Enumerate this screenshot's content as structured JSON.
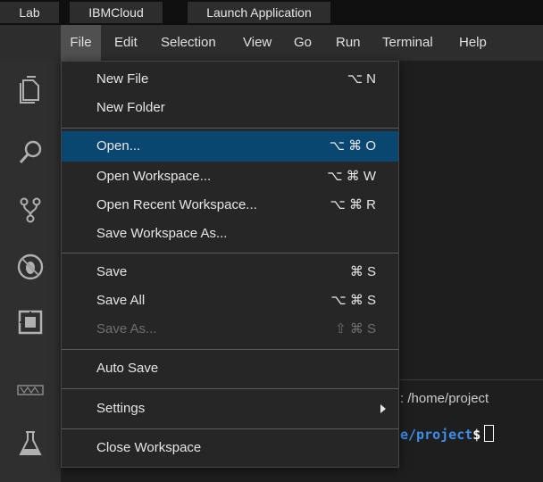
{
  "top_tabs": [
    {
      "label": "Lab"
    },
    {
      "label": "IBMCloud"
    },
    {
      "label": "Launch Application"
    }
  ],
  "menubar": [
    {
      "label": "File"
    },
    {
      "label": "Edit"
    },
    {
      "label": "Selection"
    },
    {
      "label": "View"
    },
    {
      "label": "Go"
    },
    {
      "label": "Run"
    },
    {
      "label": "Terminal"
    },
    {
      "label": "Help"
    }
  ],
  "activity_icons": [
    "files-icon",
    "search-icon",
    "source-control-icon",
    "debug-icon",
    "extensions-icon",
    "skills-network-icon",
    "lab-flask-icon"
  ],
  "file_menu": {
    "items": [
      {
        "label": "New File",
        "shortcut": "⌥ N"
      },
      {
        "label": "New Folder",
        "shortcut": ""
      },
      {
        "label": "Open...",
        "shortcut": "⌥ ⌘ O",
        "highlighted": true
      },
      {
        "label": "Open Workspace...",
        "shortcut": "⌥ ⌘ W"
      },
      {
        "label": "Open Recent Workspace...",
        "shortcut": "⌥ ⌘ R"
      },
      {
        "label": "Save Workspace As...",
        "shortcut": ""
      },
      {
        "label": "Save",
        "shortcut": "⌘ S"
      },
      {
        "label": "Save All",
        "shortcut": "⌥ ⌘ S"
      },
      {
        "label": "Save As...",
        "shortcut": "⇧ ⌘ S",
        "disabled": true
      },
      {
        "label": "Auto Save",
        "shortcut": ""
      },
      {
        "label": "Settings",
        "shortcut": "",
        "submenu": true
      },
      {
        "label": "Close Workspace",
        "shortcut": ""
      }
    ]
  },
  "terminal": {
    "line1": ": /home/project",
    "path": "e/project",
    "prompt": "$"
  },
  "colors": {
    "highlight": "#094771",
    "terminal_path": "#3b8eea"
  }
}
